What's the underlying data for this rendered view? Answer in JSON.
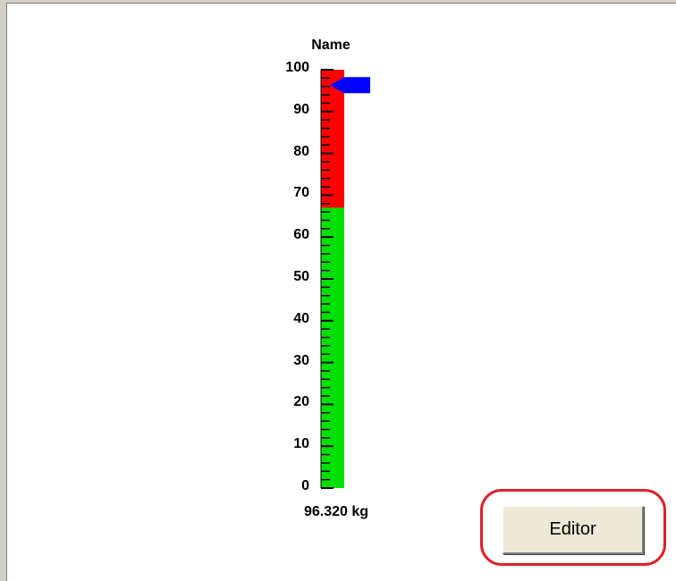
{
  "gauge": {
    "title": "Name",
    "scale_min": 0,
    "scale_max": 100,
    "major_tick_labels": [
      "100",
      "90",
      "80",
      "70",
      "60",
      "50",
      "40",
      "30",
      "20",
      "10",
      "0"
    ],
    "minor_ticks_per_major": 5,
    "zones": [
      {
        "from": 0,
        "to": 67,
        "color": "#00e000"
      },
      {
        "from": 67,
        "to": 100,
        "color": "#ff0000"
      }
    ],
    "pointer_value": 96.32,
    "pointer_color": "#0000ff",
    "readout": "96.320 kg"
  },
  "editor_button": {
    "label": "Editor",
    "highlight_color": "#e0202a"
  }
}
